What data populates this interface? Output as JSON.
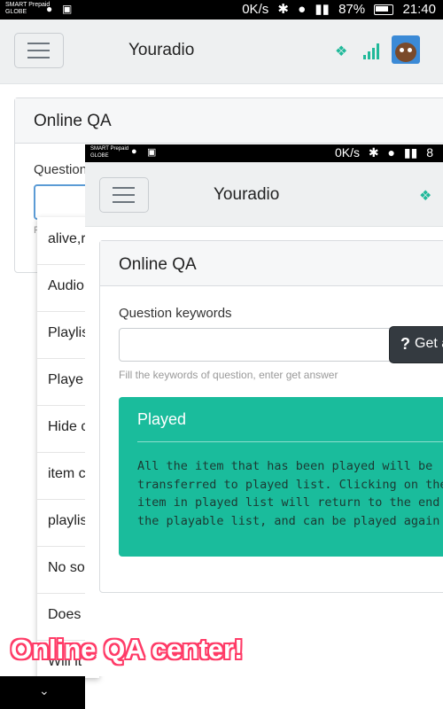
{
  "status_bar": {
    "carrier_line1": "SMART Prepaid",
    "carrier_line2": "GLOBE",
    "speed": "0K/s",
    "battery": "87%",
    "time": "21:40"
  },
  "navbar": {
    "brand": "Youradio"
  },
  "card": {
    "title": "Online QA",
    "question_label": "Question",
    "help_fragment": "F"
  },
  "dropdown": {
    "items": [
      "alive,r",
      "Audio",
      "Playlis",
      "Playe",
      "Hide c",
      "item c",
      "playlis",
      "No so",
      "Does",
      "Will it"
    ]
  },
  "inner": {
    "status_bar": {
      "carrier_line1": "SMART Prepaid",
      "carrier_line2": "GLOBE",
      "speed": "0K/s",
      "battery_fragment": "8"
    },
    "navbar": {
      "brand": "Youradio"
    },
    "card": {
      "title": "Online QA",
      "question_label": "Question keywords",
      "input_value": "",
      "button_label": "Get a",
      "help_text": "Fill the keywords of question, enter get answer"
    },
    "answer": {
      "title": "Played",
      "body": "All the item that has been played will be\ntransferred to played list. Clicking on the\nitem in played list will return to the end\nthe playable list, and can be played again"
    }
  },
  "banner": {
    "text": "Online QA center!"
  },
  "colors": {
    "accent": "#1abc9c",
    "navbar_bg": "#eef0f1",
    "banner_outline": "#ff3b67"
  }
}
